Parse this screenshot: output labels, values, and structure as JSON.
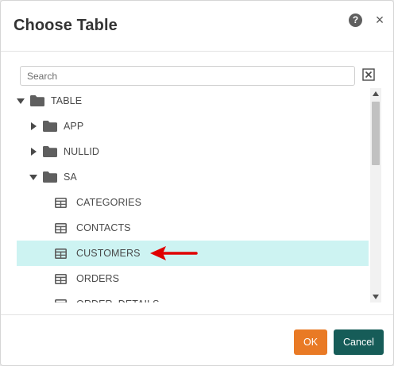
{
  "dialog": {
    "title": "Choose Table",
    "help_icon": "question-circle-icon",
    "close_icon": "close-icon",
    "close_glyph": "×",
    "help_glyph": "?"
  },
  "search": {
    "placeholder": "Search",
    "value": "",
    "clear_icon": "clear-box-icon"
  },
  "tree": {
    "items": [
      {
        "label": "TABLE",
        "type": "folder",
        "level": 0,
        "expanded": true
      },
      {
        "label": "APP",
        "type": "folder",
        "level": 1,
        "expanded": false
      },
      {
        "label": "NULLID",
        "type": "folder",
        "level": 1,
        "expanded": false
      },
      {
        "label": "SA",
        "type": "folder",
        "level": 1,
        "expanded": true
      },
      {
        "label": "CATEGORIES",
        "type": "table",
        "level": 2
      },
      {
        "label": "CONTACTS",
        "type": "table",
        "level": 2
      },
      {
        "label": "CUSTOMERS",
        "type": "table",
        "level": 2,
        "selected": true
      },
      {
        "label": "ORDERS",
        "type": "table",
        "level": 2
      },
      {
        "label": "ORDER_DETAILS",
        "type": "table",
        "level": 2
      }
    ]
  },
  "footer": {
    "ok_label": "OK",
    "cancel_label": "Cancel"
  },
  "colors": {
    "selected_row": "#cdf3f2",
    "ok_button": "#e97a25",
    "cancel_button": "#165c58",
    "annotation_arrow": "#e00000",
    "icon_gray": "#5f5f5f"
  }
}
